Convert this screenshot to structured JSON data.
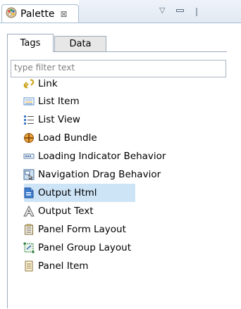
{
  "view": {
    "title": "Palette",
    "close_glyph": "⊠",
    "menu_glyph": "▽"
  },
  "subtabs": {
    "tags": "Tags",
    "data": "Data"
  },
  "filter": {
    "placeholder": "type filter text"
  },
  "items": [
    {
      "label": "Link",
      "icon": "link-icon"
    },
    {
      "label": "List Item",
      "icon": "list-item-icon"
    },
    {
      "label": "List View",
      "icon": "list-view-icon"
    },
    {
      "label": "Load Bundle",
      "icon": "load-bundle-icon"
    },
    {
      "label": "Loading Indicator Behavior",
      "icon": "loading-indicator-icon"
    },
    {
      "label": "Navigation Drag Behavior",
      "icon": "navigation-drag-icon"
    },
    {
      "label": "Output Html",
      "icon": "output-html-icon",
      "selected": true
    },
    {
      "label": "Output Text",
      "icon": "output-text-icon"
    },
    {
      "label": "Panel Form Layout",
      "icon": "panel-form-layout-icon"
    },
    {
      "label": "Panel Group Layout",
      "icon": "panel-group-layout-icon"
    },
    {
      "label": "Panel Item",
      "icon": "panel-item-icon"
    }
  ],
  "colors": {
    "selection": "#cde4f7",
    "border": "#a7bcd2"
  }
}
